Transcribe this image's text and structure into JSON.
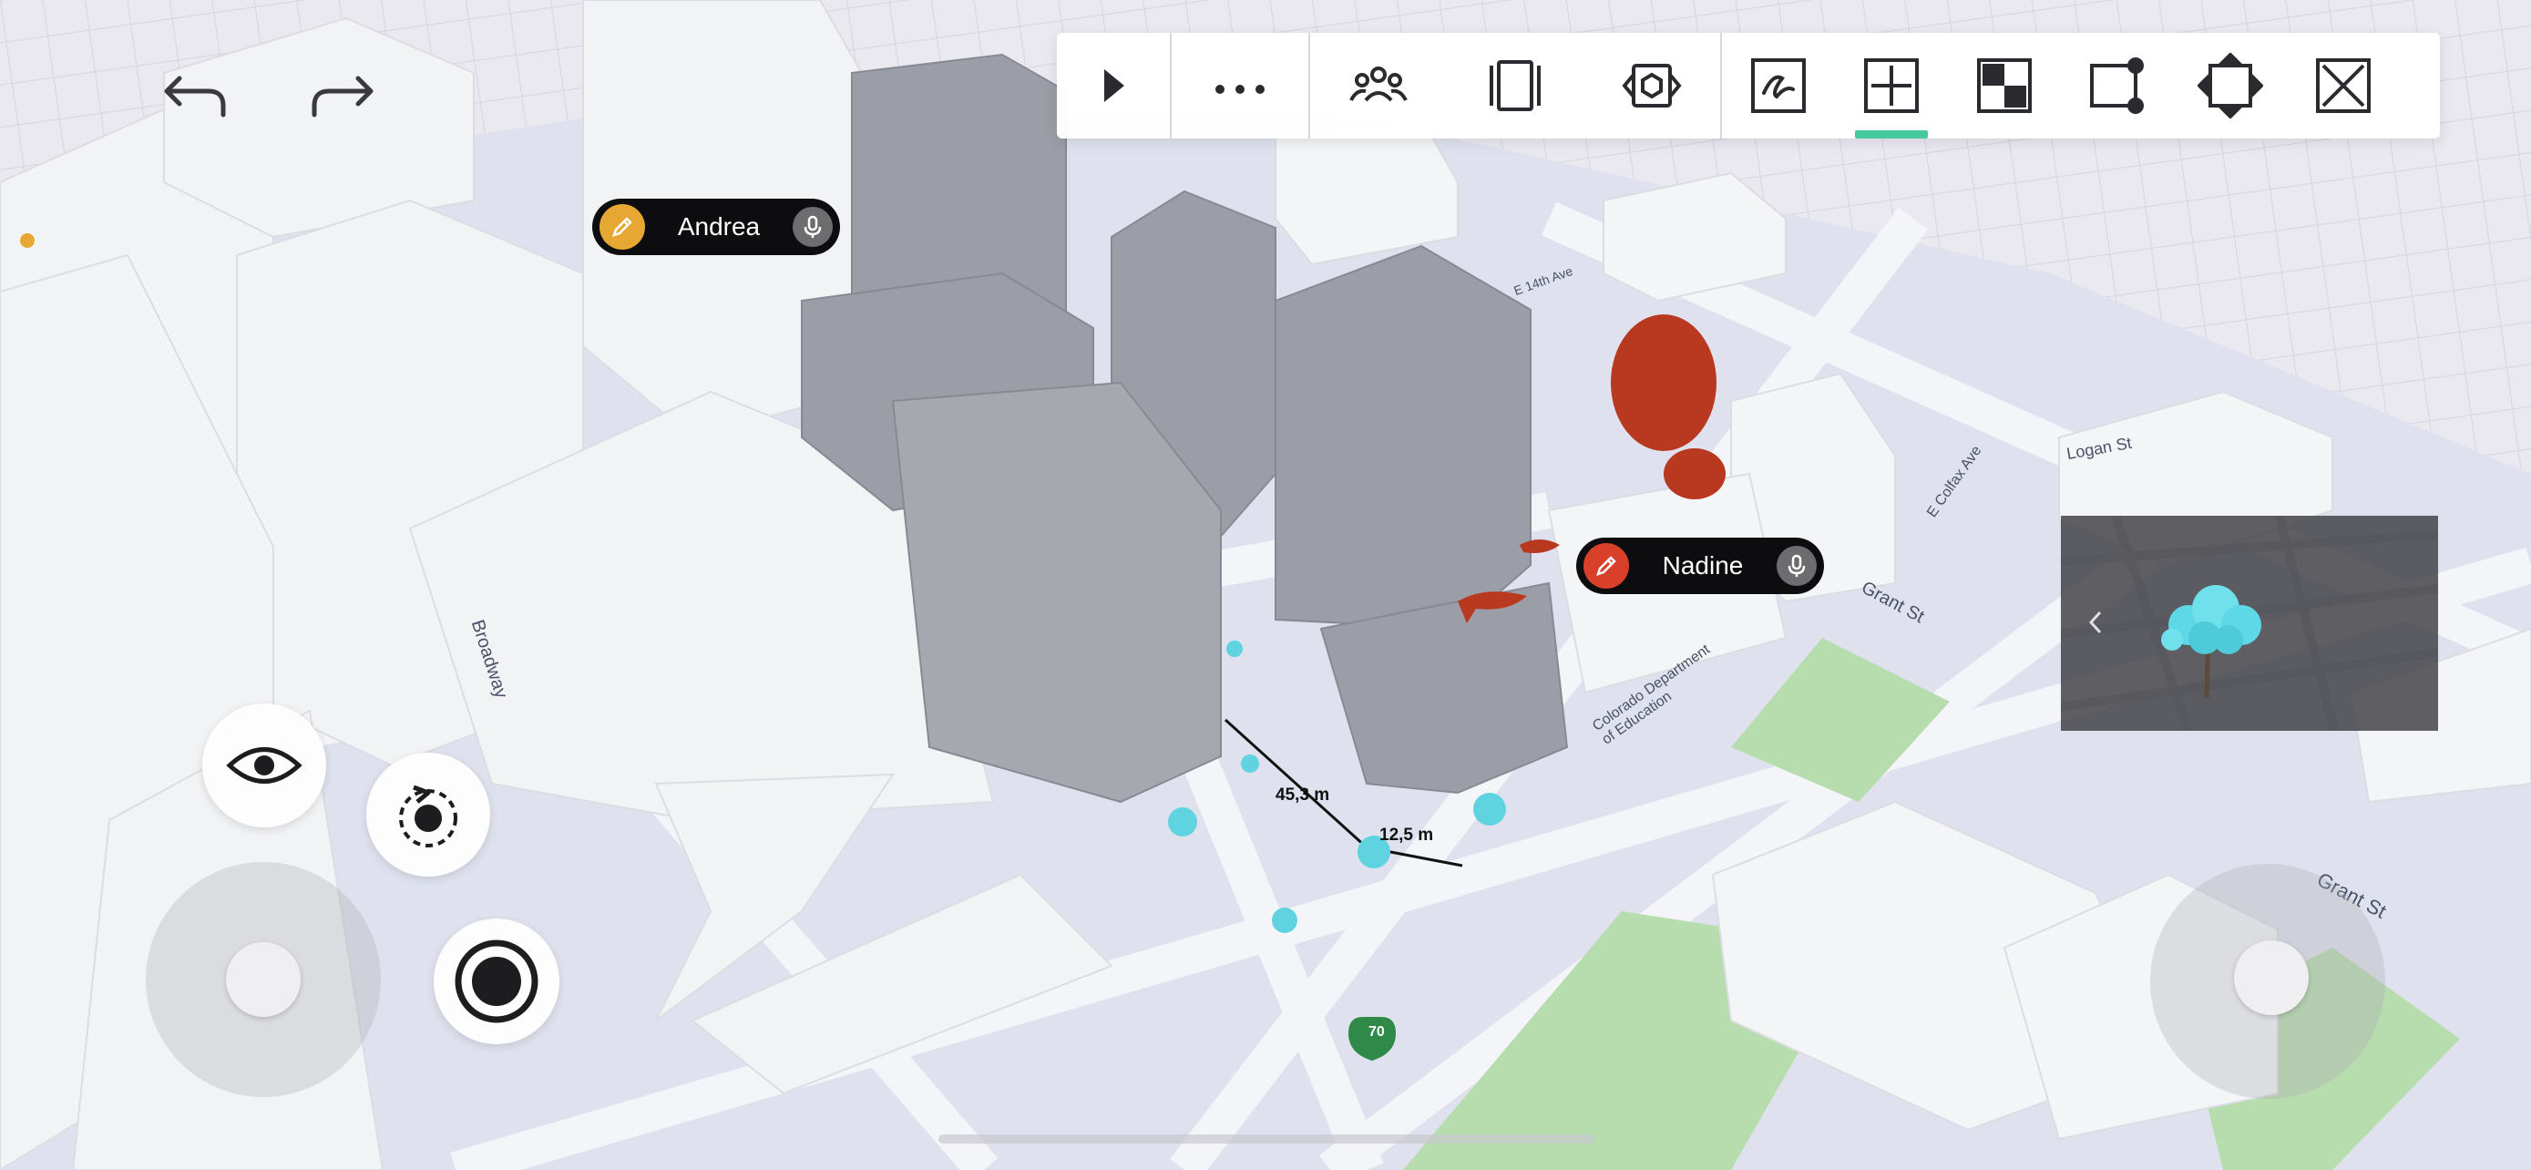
{
  "users": [
    {
      "name": "Andrea",
      "color": "#e6a833",
      "role_icon": "pencil-icon",
      "audio_icon": "microphone-icon"
    },
    {
      "name": "Nadine",
      "color": "#d8402a",
      "role_icon": "pencil-icon",
      "audio_icon": "microphone-icon"
    }
  ],
  "history": {
    "undo_icon": "undo-icon",
    "redo_icon": "redo-icon"
  },
  "toolbar": {
    "items": [
      {
        "icon": "play-icon"
      },
      {
        "icon": "more-icon"
      },
      {
        "icon": "participants-icon"
      },
      {
        "icon": "frame-icon"
      },
      {
        "icon": "ar-view-icon"
      },
      {
        "icon": "sketch-icon"
      },
      {
        "icon": "add-object-icon",
        "active": true
      },
      {
        "icon": "material-icon"
      },
      {
        "icon": "measure-icon"
      },
      {
        "icon": "resize-icon"
      },
      {
        "icon": "delete-icon"
      }
    ],
    "active_color": "#47c9a0"
  },
  "measurements": [
    {
      "label": "45,3 m"
    },
    {
      "label": "12,5 m"
    }
  ],
  "map_labels": {
    "broadway": "Broadway",
    "grant_st_1": "Grant St",
    "grant_st_2": "Grant St",
    "logan_st": "Logan St",
    "colfax": "E Colfax Ave",
    "education": "Colorado Department of Education",
    "e14th": "E 14th Ave",
    "route": "70"
  },
  "preview": {
    "object_icon": "tree-icon",
    "nav_icon": "chevron-left-icon"
  },
  "controls": {
    "view_icon": "eye-icon",
    "orbit_icon": "orbit-icon",
    "record_icon": "record-icon"
  }
}
